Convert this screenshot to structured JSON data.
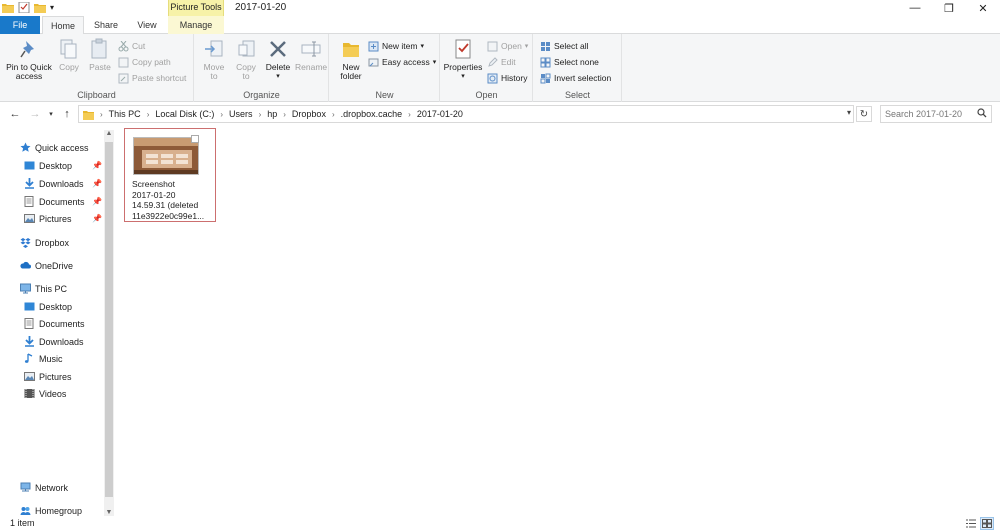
{
  "window": {
    "title": "2017-01-20",
    "context_tab_header": "Picture Tools",
    "controls": [
      "minimize",
      "restore",
      "close"
    ]
  },
  "tabs": [
    {
      "label": "File",
      "active": false
    },
    {
      "label": "Home",
      "active": true
    },
    {
      "label": "Share",
      "active": false
    },
    {
      "label": "View",
      "active": false
    },
    {
      "label": "Manage",
      "active": false
    }
  ],
  "ribbon": {
    "clipboard": {
      "label": "Clipboard",
      "pin": "Pin to Quick",
      "pin2": "access",
      "copy": "Copy",
      "paste": "Paste",
      "cut": "Cut",
      "copy_path": "Copy path",
      "paste_shortcut": "Paste shortcut"
    },
    "organize": {
      "label": "Organize",
      "move_to": "Move",
      "move_to2": "to",
      "copy_to": "Copy",
      "copy_to2": "to",
      "delete": "Delete",
      "rename": "Rename"
    },
    "new": {
      "label": "New",
      "new_folder": "New",
      "new_folder2": "folder",
      "new_item": "New item",
      "easy_access": "Easy access"
    },
    "open": {
      "label": "Open",
      "properties": "Properties",
      "open": "Open",
      "edit": "Edit",
      "history": "History"
    },
    "select": {
      "label": "Select",
      "select_all": "Select all",
      "select_none": "Select none",
      "invert": "Invert selection"
    }
  },
  "address": {
    "crumbs": [
      "This PC",
      "Local Disk (C:)",
      "Users",
      "hp",
      "Dropbox",
      ".dropbox.cache",
      "2017-01-20"
    ],
    "search_placeholder": "Search 2017-01-20"
  },
  "nav": {
    "quick_access": "Quick access",
    "qa_items": [
      "Desktop",
      "Downloads",
      "Documents",
      "Pictures"
    ],
    "dropbox": "Dropbox",
    "onedrive": "OneDrive",
    "this_pc": "This PC",
    "pc_items": [
      "Desktop",
      "Documents",
      "Downloads",
      "Music",
      "Pictures",
      "Videos"
    ],
    "network": "Network",
    "homegroup": "Homegroup"
  },
  "files": [
    {
      "line1": "Screenshot",
      "line2": "2017-01-20",
      "line3": "14.59.31 (deleted",
      "line4": "11e3922e0c99e1..."
    }
  ],
  "status": {
    "count": "1 item"
  },
  "colors": {
    "file_tab": "#1979ca",
    "context_tab": "#f7f2a8",
    "selection_border": "#cc6f6f",
    "ribbon_bg": "#f5f6f7"
  }
}
